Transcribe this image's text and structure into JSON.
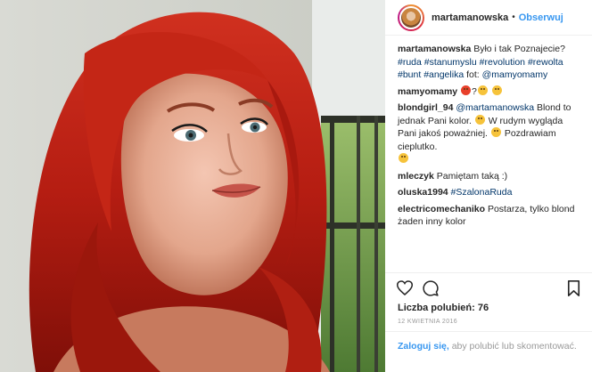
{
  "post": {
    "username": "martamanowska",
    "separator": "•",
    "follow_label": "Obserwuj"
  },
  "comments": [
    {
      "user": "martamanowska",
      "text": "Było i tak Poznajecie?",
      "tags": [
        "#ruda",
        "#stanumyslu",
        "#revolution",
        "#rewolta",
        "#bunt",
        "#angelika"
      ],
      "credit_prefix": "fot:",
      "credit_mention": "@mamyomamy"
    },
    {
      "user": "mamyomamy",
      "text": "",
      "emojis": [
        "devil",
        "question-mark",
        "sunglasses",
        "smile"
      ],
      "question": "?"
    },
    {
      "user": "blondgirl_94",
      "mention": "@martamanowska",
      "text1": "Blond to jednak Pani kolor.",
      "text2": "W rudym wygląda Pani jakoś poważniej.",
      "text3": "Pozdrawiam cieplutko."
    },
    {
      "user": "mleczyk",
      "text": "Pamiętam taką :)"
    },
    {
      "user": "oluska1994",
      "tag": "#SzalonaRuda"
    },
    {
      "user": "electricomechaniko",
      "text": "Postarza, tylko blond żaden inny kolor"
    }
  ],
  "actions": {
    "like_icon": "heart-icon",
    "comment_icon": "comment-icon",
    "save_icon": "bookmark-icon"
  },
  "likes_text": "Liczba polubień: 76",
  "date_text": "12 KWIETNIA 2016",
  "login": {
    "link": "Zaloguj się,",
    "rest": "aby polubić lub skomentować."
  },
  "colors": {
    "link_blue": "#3897f0",
    "hashtag": "#003569",
    "muted": "#999999"
  }
}
